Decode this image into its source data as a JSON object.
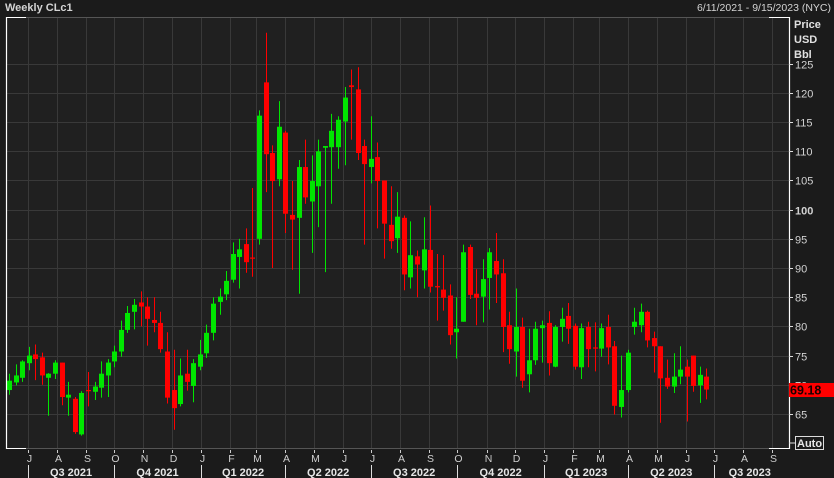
{
  "header": {
    "title": "Weekly CLc1",
    "date_range": "6/11/2021 - 9/15/2023 (NYC)"
  },
  "axis_units": [
    "Price",
    "USD",
    "Bbl"
  ],
  "last_price_label": "69.18",
  "auto_button": "Auto",
  "colors": {
    "up": "#00e600",
    "down": "#ff0000",
    "grid": "#393939",
    "plot_bg": "#202020"
  },
  "chart_data": {
    "type": "candlestick",
    "title": "Weekly CLc1",
    "start_date": "2021-06-11",
    "end_date": "2023-09-15",
    "ylabel": "Price USD Bbl",
    "ylim": [
      59,
      133
    ],
    "y_ticks": [
      65,
      70,
      75,
      80,
      85,
      90,
      95,
      100,
      105,
      110,
      115,
      120,
      125
    ],
    "grid": true,
    "last_price": 69.18,
    "month_ticks": [
      {
        "label": "J",
        "date": "2021-07-01"
      },
      {
        "label": "A",
        "date": "2021-08-01"
      },
      {
        "label": "S",
        "date": "2021-09-01"
      },
      {
        "label": "O",
        "date": "2021-10-01"
      },
      {
        "label": "N",
        "date": "2021-11-01"
      },
      {
        "label": "D",
        "date": "2021-12-01"
      },
      {
        "label": "J",
        "date": "2022-01-01"
      },
      {
        "label": "F",
        "date": "2022-02-01"
      },
      {
        "label": "M",
        "date": "2022-03-01"
      },
      {
        "label": "A",
        "date": "2022-04-01"
      },
      {
        "label": "M",
        "date": "2022-05-01"
      },
      {
        "label": "J",
        "date": "2022-06-01"
      },
      {
        "label": "J",
        "date": "2022-07-01"
      },
      {
        "label": "A",
        "date": "2022-08-01"
      },
      {
        "label": "S",
        "date": "2022-09-01"
      },
      {
        "label": "O",
        "date": "2022-10-01"
      },
      {
        "label": "N",
        "date": "2022-11-01"
      },
      {
        "label": "D",
        "date": "2022-12-01"
      },
      {
        "label": "J",
        "date": "2023-01-01"
      },
      {
        "label": "F",
        "date": "2023-02-01"
      },
      {
        "label": "M",
        "date": "2023-03-01"
      },
      {
        "label": "A",
        "date": "2023-04-01"
      },
      {
        "label": "M",
        "date": "2023-05-01"
      },
      {
        "label": "J",
        "date": "2023-06-01"
      },
      {
        "label": "J",
        "date": "2023-07-01"
      },
      {
        "label": "A",
        "date": "2023-08-01"
      },
      {
        "label": "S",
        "date": "2023-09-01"
      }
    ],
    "quarter_ticks": [
      {
        "label": "Q3 2021",
        "start": "2021-07-01",
        "end": "2021-10-01"
      },
      {
        "label": "Q4 2021",
        "start": "2021-10-01",
        "end": "2022-01-01"
      },
      {
        "label": "Q1 2022",
        "start": "2022-01-01",
        "end": "2022-04-01"
      },
      {
        "label": "Q2 2022",
        "start": "2022-04-01",
        "end": "2022-07-01"
      },
      {
        "label": "Q3 2022",
        "start": "2022-07-01",
        "end": "2022-10-01"
      },
      {
        "label": "Q4 2022",
        "start": "2022-10-01",
        "end": "2023-01-01"
      },
      {
        "label": "Q1 2023",
        "start": "2023-01-01",
        "end": "2023-04-01"
      },
      {
        "label": "Q2 2023",
        "start": "2023-04-01",
        "end": "2023-07-01"
      },
      {
        "label": "Q3 2023",
        "start": "2023-07-01",
        "end": "2023-09-15"
      }
    ],
    "ohlc_fields": [
      "open",
      "high",
      "low",
      "close"
    ],
    "ohlc": [
      [
        69.1,
        71.9,
        68.3,
        70.7
      ],
      [
        70.4,
        73.5,
        69.9,
        71.6
      ],
      [
        71.2,
        74.2,
        70.5,
        74.0
      ],
      [
        73.7,
        76.5,
        72.5,
        75.0
      ],
      [
        75.2,
        76.9,
        70.8,
        74.4
      ],
      [
        74.7,
        75.5,
        70.0,
        71.6
      ],
      [
        71.2,
        72.0,
        64.7,
        71.9
      ],
      [
        71.9,
        74.2,
        71.0,
        73.8
      ],
      [
        73.8,
        73.8,
        66.5,
        67.9
      ],
      [
        67.8,
        70.5,
        64.7,
        68.3
      ],
      [
        67.6,
        67.9,
        61.6,
        61.9
      ],
      [
        61.5,
        68.9,
        61.3,
        68.6
      ],
      [
        69.1,
        72.2,
        66.3,
        69.0
      ],
      [
        68.8,
        70.5,
        67.4,
        69.7
      ],
      [
        69.5,
        74.0,
        67.8,
        71.9
      ],
      [
        71.6,
        74.4,
        67.9,
        73.8
      ],
      [
        74.0,
        76.7,
        73.0,
        75.7
      ],
      [
        75.7,
        81.0,
        74.8,
        79.4
      ],
      [
        79.4,
        83.5,
        78.9,
        82.3
      ],
      [
        82.5,
        84.7,
        79.5,
        83.7
      ],
      [
        84.1,
        86.0,
        80.0,
        83.4
      ],
      [
        83.4,
        85.0,
        76.7,
        81.3
      ],
      [
        81.1,
        85.0,
        79.0,
        80.6
      ],
      [
        80.6,
        82.5,
        75.5,
        76.1
      ],
      [
        75.7,
        79.0,
        66.8,
        67.8
      ],
      [
        69.1,
        76.0,
        62.3,
        66.0
      ],
      [
        66.7,
        74.5,
        66.3,
        71.6
      ],
      [
        71.9,
        76.0,
        69.0,
        70.5
      ],
      [
        69.8,
        74.4,
        67.0,
        73.7
      ],
      [
        73.1,
        77.7,
        72.5,
        75.2
      ],
      [
        75.4,
        80.3,
        74.6,
        78.9
      ],
      [
        78.9,
        85.0,
        77.6,
        83.9
      ],
      [
        84.2,
        86.5,
        82.0,
        85.1
      ],
      [
        85.5,
        89.5,
        84.5,
        87.8
      ],
      [
        88.0,
        94.4,
        87.5,
        92.4
      ],
      [
        91.9,
        95.0,
        86.5,
        93.2
      ],
      [
        94.1,
        96.8,
        89.2,
        91.0
      ],
      [
        91.8,
        103.7,
        88.5,
        91.6
      ],
      [
        95.0,
        117.0,
        94.0,
        116.1
      ],
      [
        121.8,
        130.3,
        103.0,
        109.5
      ],
      [
        109.7,
        111.0,
        90.0,
        104.9
      ],
      [
        105.2,
        118.6,
        104.0,
        114.2
      ],
      [
        113.2,
        113.5,
        96.0,
        99.3
      ],
      [
        99.1,
        104.9,
        89.7,
        98.3
      ],
      [
        98.6,
        108.5,
        85.6,
        107.3
      ],
      [
        107.3,
        112.0,
        101.0,
        102.1
      ],
      [
        101.4,
        109.3,
        92.6,
        104.9
      ],
      [
        104.0,
        112.0,
        97.0,
        110.0
      ],
      [
        110.6,
        110.9,
        89.3,
        110.9
      ],
      [
        110.7,
        116.4,
        101.0,
        113.5
      ],
      [
        110.7,
        116.0,
        107.0,
        115.4
      ],
      [
        115.1,
        121.0,
        107.6,
        119.2
      ],
      [
        121.3,
        124.0,
        112.0,
        121.0
      ],
      [
        120.6,
        124.4,
        108.5,
        109.7
      ],
      [
        110.9,
        112.0,
        94.0,
        107.8
      ],
      [
        107.3,
        116.0,
        104.5,
        108.7
      ],
      [
        109.0,
        111.5,
        96.8,
        104.9
      ],
      [
        105.0,
        105.0,
        91.6,
        97.6
      ],
      [
        97.4,
        104.0,
        93.3,
        94.6
      ],
      [
        95.1,
        103.0,
        92.6,
        98.8
      ],
      [
        98.6,
        99.0,
        86.2,
        88.9
      ],
      [
        88.4,
        98.0,
        86.5,
        92.2
      ],
      [
        92.0,
        93.0,
        85.0,
        90.6
      ],
      [
        89.6,
        98.7,
        86.5,
        93.2
      ],
      [
        93.1,
        100.7,
        85.8,
        86.8
      ],
      [
        86.9,
        92.4,
        81.0,
        86.7
      ],
      [
        86.3,
        92.2,
        82.7,
        84.9
      ],
      [
        85.3,
        87.2,
        76.9,
        78.5
      ],
      [
        79.0,
        85.0,
        74.5,
        79.6
      ],
      [
        80.8,
        94.0,
        80.8,
        92.7
      ],
      [
        93.6,
        94.0,
        84.7,
        85.4
      ],
      [
        85.6,
        89.8,
        80.2,
        84.9
      ],
      [
        85.1,
        91.5,
        80.7,
        88.1
      ],
      [
        88.3,
        93.4,
        82.9,
        92.7
      ],
      [
        91.2,
        96.0,
        84.0,
        88.9
      ],
      [
        89.1,
        91.5,
        75.6,
        79.9
      ],
      [
        80.2,
        82.5,
        73.6,
        76.1
      ],
      [
        75.7,
        86.5,
        71.4,
        79.9
      ],
      [
        79.9,
        81.5,
        69.5,
        70.7
      ],
      [
        71.8,
        79.6,
        68.7,
        74.2
      ],
      [
        74.2,
        80.8,
        73.4,
        79.6
      ],
      [
        79.7,
        81.0,
        73.8,
        80.2
      ],
      [
        80.6,
        82.6,
        71.6,
        73.7
      ],
      [
        73.1,
        80.2,
        73.0,
        79.9
      ],
      [
        79.9,
        83.2,
        77.4,
        81.3
      ],
      [
        81.8,
        84.0,
        77.0,
        79.6
      ],
      [
        80.1,
        80.5,
        72.6,
        73.1
      ],
      [
        73.0,
        80.5,
        71.0,
        79.7
      ],
      [
        79.9,
        80.8,
        73.0,
        76.1
      ],
      [
        76.4,
        80.7,
        72.3,
        76.2
      ],
      [
        76.2,
        80.5,
        74.8,
        79.7
      ],
      [
        79.9,
        82.0,
        73.5,
        76.4
      ],
      [
        76.6,
        77.5,
        64.9,
        66.4
      ],
      [
        66.2,
        75.0,
        64.4,
        69.1
      ],
      [
        69.1,
        76.0,
        68.7,
        75.5
      ],
      [
        79.9,
        83.2,
        78.6,
        80.8
      ],
      [
        80.2,
        83.9,
        79.0,
        82.5
      ],
      [
        82.5,
        82.7,
        76.4,
        77.6
      ],
      [
        78.0,
        79.1,
        72.1,
        76.6
      ],
      [
        76.6,
        76.6,
        63.5,
        71.1
      ],
      [
        71.2,
        74.3,
        69.3,
        69.7
      ],
      [
        69.7,
        75.4,
        68.6,
        71.4
      ],
      [
        71.4,
        76.6,
        70.1,
        72.6
      ],
      [
        73.1,
        74.3,
        63.7,
        71.4
      ],
      [
        75.0,
        75.0,
        68.8,
        69.8
      ],
      [
        69.9,
        73.1,
        66.9,
        71.7
      ],
      [
        71.4,
        72.8,
        67.5,
        69.18
      ]
    ]
  }
}
